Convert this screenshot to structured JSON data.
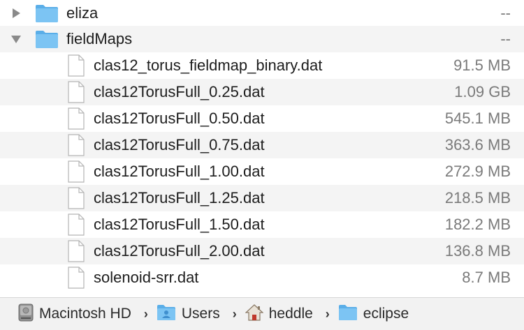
{
  "folders": [
    {
      "name": "eliza",
      "size": "--",
      "expanded": false
    },
    {
      "name": "fieldMaps",
      "size": "--",
      "expanded": true
    }
  ],
  "files": [
    {
      "name": "clas12_torus_fieldmap_binary.dat",
      "size": "91.5 MB"
    },
    {
      "name": "clas12TorusFull_0.25.dat",
      "size": "1.09 GB"
    },
    {
      "name": "clas12TorusFull_0.50.dat",
      "size": "545.1 MB"
    },
    {
      "name": "clas12TorusFull_0.75.dat",
      "size": "363.6 MB"
    },
    {
      "name": "clas12TorusFull_1.00.dat",
      "size": "272.9 MB"
    },
    {
      "name": "clas12TorusFull_1.25.dat",
      "size": "218.5 MB"
    },
    {
      "name": "clas12TorusFull_1.50.dat",
      "size": "182.2 MB"
    },
    {
      "name": "clas12TorusFull_2.00.dat",
      "size": "136.8 MB"
    },
    {
      "name": "solenoid-srr.dat",
      "size": "8.7 MB"
    }
  ],
  "path_bar": {
    "items": [
      {
        "label": "Macintosh HD",
        "icon": "hard-drive-icon"
      },
      {
        "label": "Users",
        "icon": "users-folder-icon"
      },
      {
        "label": "heddle",
        "icon": "home-icon"
      },
      {
        "label": "eclipse",
        "icon": "folder-icon"
      }
    ],
    "separator": "›"
  },
  "colors": {
    "folder_blue": "#6cb8ec",
    "row_alt": "#f4f4f4",
    "size_text": "#7a7a7a"
  }
}
